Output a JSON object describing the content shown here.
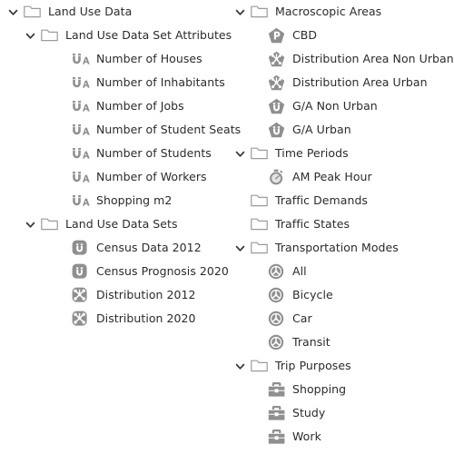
{
  "tree": {
    "left_column": [
      {
        "label": "Land Use Data",
        "level": 0,
        "icon": "folder-icon",
        "twisty": "chevron-down-icon",
        "expanded": true
      },
      {
        "label": "Land Use Data Set Attributes",
        "level": 1,
        "icon": "folder-icon",
        "twisty": "chevron-down-icon",
        "expanded": true
      },
      {
        "label": "Number of Houses",
        "level": 2,
        "icon": "attribute-magnet-a-icon",
        "twisty": "none",
        "expanded": false
      },
      {
        "label": "Number of Inhabitants",
        "level": 2,
        "icon": "attribute-magnet-a-icon",
        "twisty": "none",
        "expanded": false
      },
      {
        "label": "Number of Jobs",
        "level": 2,
        "icon": "attribute-magnet-a-icon",
        "twisty": "none",
        "expanded": false
      },
      {
        "label": "Number of Student Seats",
        "level": 2,
        "icon": "attribute-magnet-a-icon",
        "twisty": "none",
        "expanded": false
      },
      {
        "label": "Number of Students",
        "level": 2,
        "icon": "attribute-magnet-a-icon",
        "twisty": "none",
        "expanded": false
      },
      {
        "label": "Number of Workers",
        "level": 2,
        "icon": "attribute-magnet-a-icon",
        "twisty": "none",
        "expanded": false
      },
      {
        "label": "Shopping m2",
        "level": 2,
        "icon": "attribute-magnet-a-icon",
        "twisty": "none",
        "expanded": false
      },
      {
        "label": "Land Use Data Sets",
        "level": 1,
        "icon": "folder-icon",
        "twisty": "chevron-down-icon",
        "expanded": true
      },
      {
        "label": "Census Data 2012",
        "level": 2,
        "icon": "dataset-magnet-icon",
        "twisty": "none",
        "expanded": false
      },
      {
        "label": "Census Prognosis 2020",
        "level": 2,
        "icon": "dataset-magnet-icon",
        "twisty": "none",
        "expanded": false
      },
      {
        "label": "Distribution 2012",
        "level": 2,
        "icon": "distribution-burst-icon",
        "twisty": "none",
        "expanded": false
      },
      {
        "label": "Distribution 2020",
        "level": 2,
        "icon": "distribution-burst-icon",
        "twisty": "none",
        "expanded": false
      }
    ],
    "right_column": [
      {
        "label": "Macroscopic Areas",
        "level": 0,
        "icon": "folder-icon",
        "twisty": "chevron-down-icon",
        "expanded": true
      },
      {
        "label": "CBD",
        "level": 1,
        "icon": "pentagon-p-icon",
        "twisty": "none",
        "expanded": false
      },
      {
        "label": "Distribution Area Non Urban",
        "level": 1,
        "icon": "pentagon-burst-icon",
        "twisty": "none",
        "expanded": false
      },
      {
        "label": "Distribution Area Urban",
        "level": 1,
        "icon": "pentagon-burst-icon",
        "twisty": "none",
        "expanded": false
      },
      {
        "label": "G/A Non Urban",
        "level": 1,
        "icon": "pentagon-magnet-icon",
        "twisty": "none",
        "expanded": false
      },
      {
        "label": "G/A Urban",
        "level": 1,
        "icon": "pentagon-magnet-icon",
        "twisty": "none",
        "expanded": false
      },
      {
        "label": "Time Periods",
        "level": 0,
        "icon": "folder-icon",
        "twisty": "chevron-down-icon",
        "expanded": true
      },
      {
        "label": "AM Peak Hour",
        "level": 1,
        "icon": "stopwatch-icon",
        "twisty": "none",
        "expanded": false
      },
      {
        "label": "Traffic Demands",
        "level": 0,
        "icon": "folder-icon",
        "twisty": "none",
        "expanded": false
      },
      {
        "label": "Traffic States",
        "level": 0,
        "icon": "folder-icon",
        "twisty": "none",
        "expanded": false
      },
      {
        "label": "Transportation Modes",
        "level": 0,
        "icon": "folder-icon",
        "twisty": "chevron-down-icon",
        "expanded": true
      },
      {
        "label": "All",
        "level": 1,
        "icon": "steering-wheel-icon",
        "twisty": "none",
        "expanded": false
      },
      {
        "label": "Bicycle",
        "level": 1,
        "icon": "steering-wheel-icon",
        "twisty": "none",
        "expanded": false
      },
      {
        "label": "Car",
        "level": 1,
        "icon": "steering-wheel-icon",
        "twisty": "none",
        "expanded": false
      },
      {
        "label": "Transit",
        "level": 1,
        "icon": "steering-wheel-icon",
        "twisty": "none",
        "expanded": false
      },
      {
        "label": "Trip Purposes",
        "level": 0,
        "icon": "folder-icon",
        "twisty": "chevron-down-icon",
        "expanded": true
      },
      {
        "label": "Shopping",
        "level": 1,
        "icon": "briefcase-icon",
        "twisty": "none",
        "expanded": false
      },
      {
        "label": "Study",
        "level": 1,
        "icon": "briefcase-icon",
        "twisty": "none",
        "expanded": false
      },
      {
        "label": "Work",
        "level": 1,
        "icon": "briefcase-icon",
        "twisty": "none",
        "expanded": false
      }
    ]
  },
  "colors": {
    "text": "#2b2b2b",
    "icon_gray": "#8f8f8f",
    "folder_outline": "#9b9b9b",
    "twisty": "#3a3a3a",
    "background": "#ffffff"
  }
}
